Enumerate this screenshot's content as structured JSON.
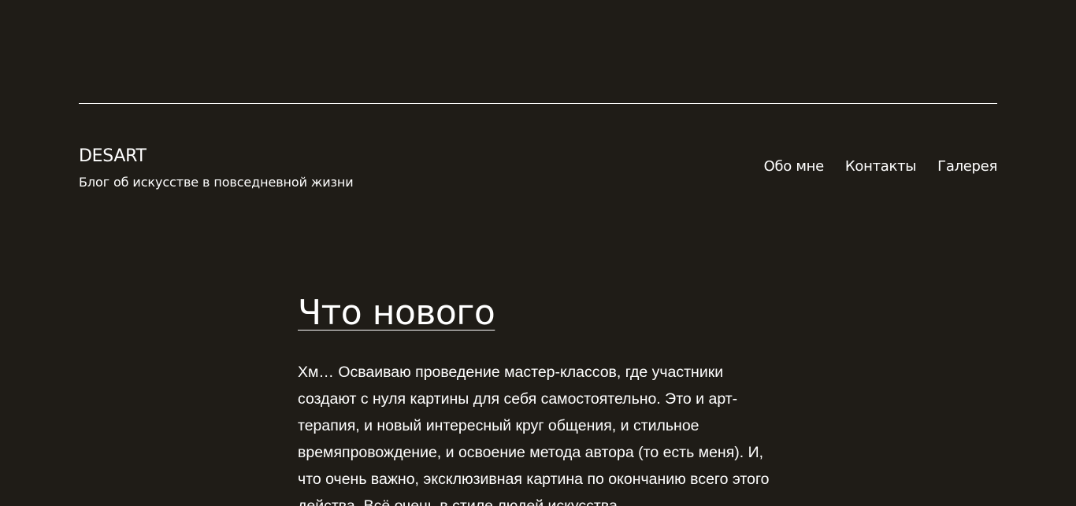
{
  "site": {
    "title": "DESART",
    "tagline": "Блог об искусстве в повседневной жизни"
  },
  "nav": {
    "items": [
      {
        "label": "Обо мне"
      },
      {
        "label": "Контакты"
      },
      {
        "label": "Галерея"
      }
    ]
  },
  "post": {
    "title": "Что нового",
    "body": "Хм… Осваиваю проведение мастер-классов, где участники создают с нуля картины для себя самостоятельно. Это и арт-терапия, и новый интересный круг общения, и стильное времяпровождение, и освоение метода автора (то есть меня). И, что очень важно, эксклюзивная картина по окончанию всего этого действа. Всё очень в стиле людей искусства."
  },
  "colors": {
    "background": "#1f1c17",
    "text": "#ffffff"
  }
}
